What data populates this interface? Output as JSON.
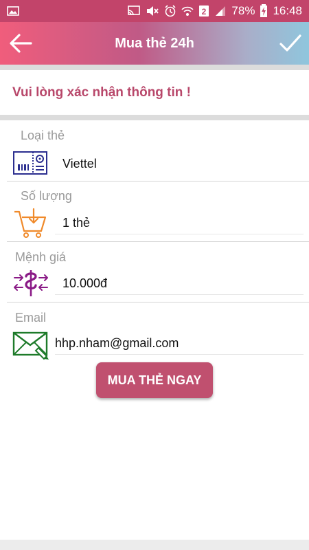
{
  "status_bar": {
    "battery_percent": "78%",
    "sim_badge": "2",
    "time": "16:48",
    "icons": [
      "image-icon",
      "cast-icon",
      "mute-icon",
      "alarm-icon",
      "wifi-icon",
      "sim-badge",
      "signal-icon",
      "battery-charging-icon"
    ]
  },
  "app_bar": {
    "title": "Mua thẻ 24h",
    "back_icon": "arrow-left-icon",
    "confirm_icon": "check-icon"
  },
  "notice": "Vui lòng xác nhận thông tin !",
  "fields": [
    {
      "label": "Loại thẻ",
      "value": "Viettel",
      "icon": "card-icon"
    },
    {
      "label": "Số lượng",
      "value": "1 thẻ",
      "icon": "cart-icon"
    },
    {
      "label": "Mệnh giá",
      "value": "10.000đ",
      "icon": "dollar-exchange-icon"
    },
    {
      "label": "Email",
      "value": "hhp.nham@gmail.com",
      "icon": "email-icon"
    }
  ],
  "buy_button": "MUA THẺ NGAY",
  "colors": {
    "status_bar": "#c2446a",
    "accent": "#b8476a",
    "button": "#c0506f",
    "card_icon": "#2b2e8f",
    "cart_icon": "#f08a2a",
    "dollar_icon": "#8a1a86",
    "email_icon": "#1e7b2a"
  }
}
